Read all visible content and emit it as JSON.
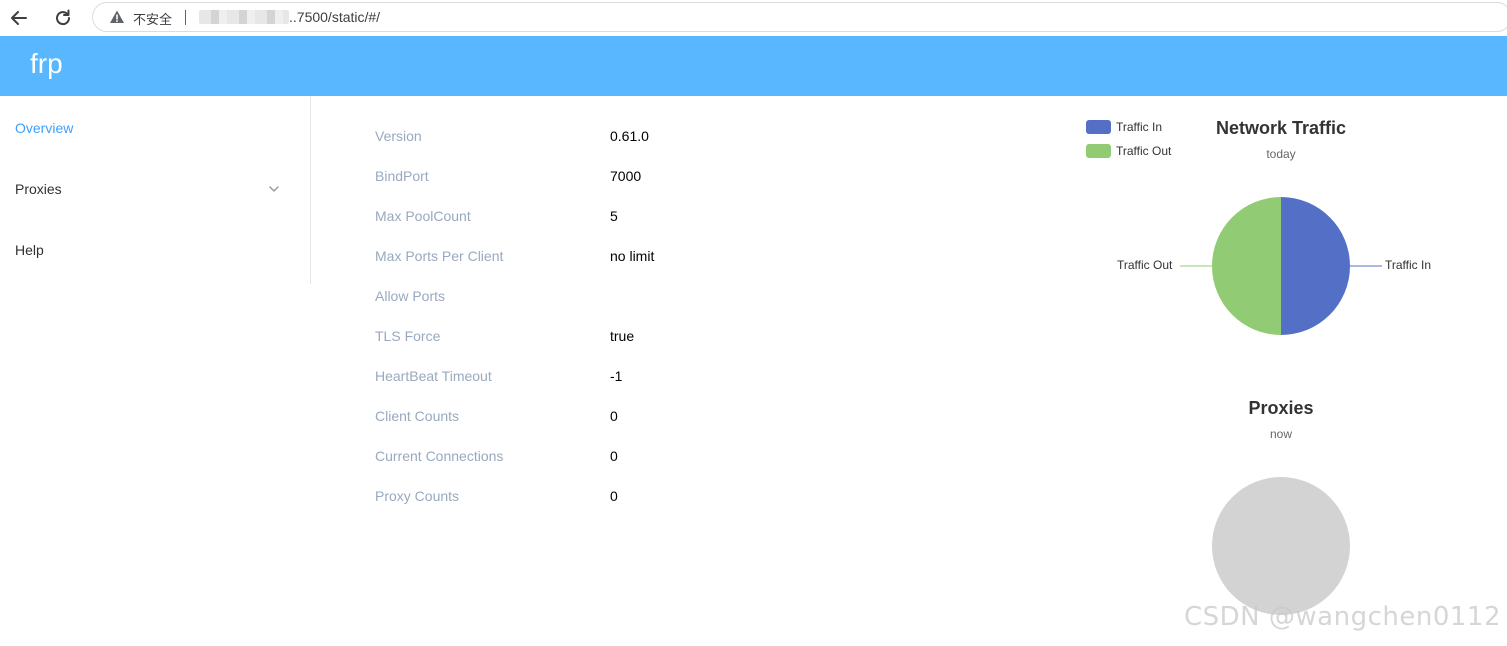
{
  "browser": {
    "security_label": "不安全",
    "url_visible": "..7500/static/#/"
  },
  "app": {
    "brand": "frp"
  },
  "sidebar": {
    "items": [
      {
        "label": "Overview",
        "active": true
      },
      {
        "label": "Proxies",
        "expandable": true
      },
      {
        "label": "Help"
      }
    ]
  },
  "server_info": [
    {
      "label": "Version",
      "value": "0.61.0"
    },
    {
      "label": "BindPort",
      "value": "7000"
    },
    {
      "label": "Max PoolCount",
      "value": "5"
    },
    {
      "label": "Max Ports Per Client",
      "value": "no limit"
    },
    {
      "label": "Allow Ports",
      "value": ""
    },
    {
      "label": "TLS Force",
      "value": "true"
    },
    {
      "label": "HeartBeat Timeout",
      "value": "-1"
    },
    {
      "label": "Client Counts",
      "value": "0"
    },
    {
      "label": "Current Connections",
      "value": "0"
    },
    {
      "label": "Proxy Counts",
      "value": "0"
    }
  ],
  "colors": {
    "header": "#58b7ff",
    "active_menu": "#409eff",
    "label": "#99a9bf",
    "traffic_in": "#5470c6",
    "traffic_out": "#91cc75",
    "empty_pie": "#d3d3d3"
  },
  "chart_data": [
    {
      "type": "pie",
      "title": "Network Traffic",
      "subtitle": "today",
      "legend": [
        "Traffic In",
        "Traffic Out"
      ],
      "legend_position": "top-left",
      "slices": [
        {
          "name": "Traffic In",
          "value": 50,
          "color": "#5470c6"
        },
        {
          "name": "Traffic Out",
          "value": 50,
          "color": "#91cc75"
        }
      ]
    },
    {
      "type": "pie",
      "title": "Proxies",
      "subtitle": "now",
      "slices": []
    }
  ],
  "watermark": "CSDN @wangchen0112"
}
